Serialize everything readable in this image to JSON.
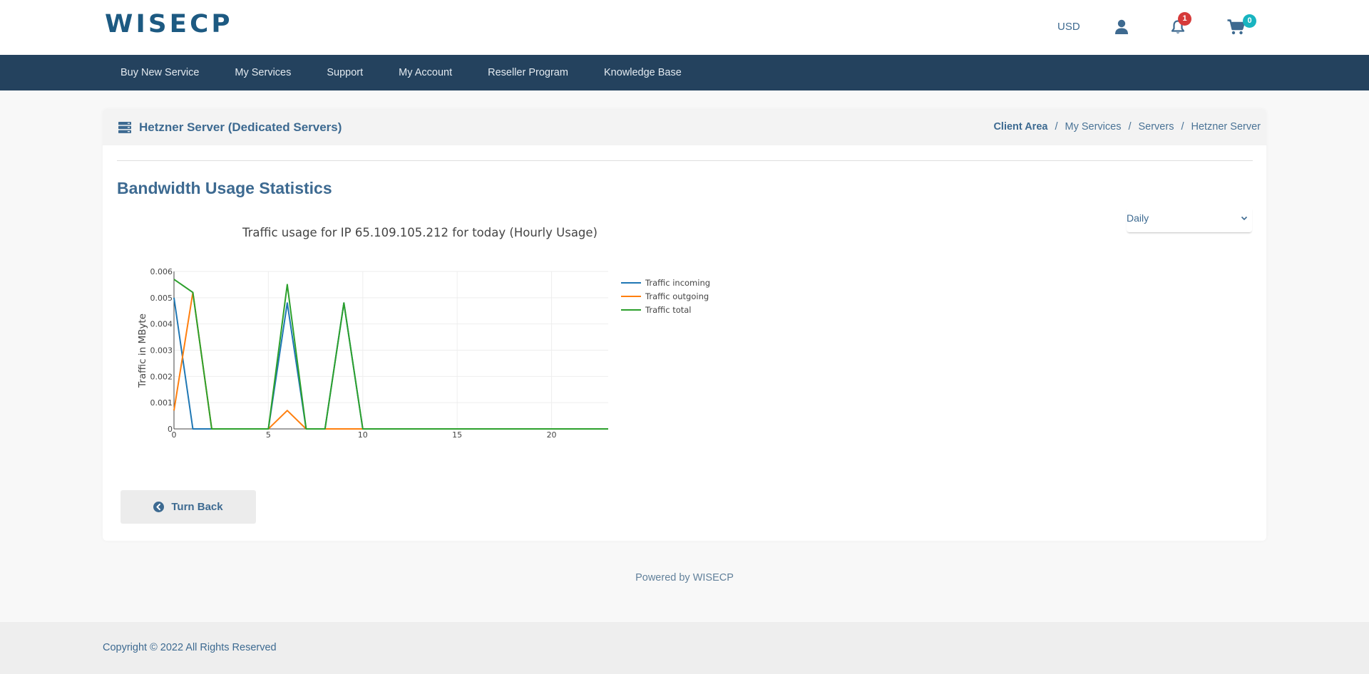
{
  "header": {
    "logo": "WISECP",
    "currency": "USD",
    "icons": [
      "user-icon",
      "bell-icon",
      "cart-icon"
    ],
    "notifications_count": "1",
    "cart_count": "0"
  },
  "nav": {
    "items": [
      {
        "label": "Buy New Service"
      },
      {
        "label": "My Services"
      },
      {
        "label": "Support"
      },
      {
        "label": "My Account"
      },
      {
        "label": "Reseller Program"
      },
      {
        "label": "Knowledge Base"
      }
    ]
  },
  "page": {
    "title_icon": "server-icon",
    "title": "Hetzner Server (Dedicated Servers)",
    "breadcrumb": [
      {
        "label": "Client Area"
      },
      {
        "label": "My Services"
      },
      {
        "label": "Servers"
      },
      {
        "label": "Hetzner Server"
      }
    ],
    "breadcrumb_separator": "/"
  },
  "section": {
    "heading": "Bandwidth Usage Statistics",
    "period_select": {
      "selected": "Daily"
    }
  },
  "chart_data": {
    "type": "line",
    "title": "Traffic usage for IP 65.109.105.212 for today (Hourly Usage)",
    "xlabel": "",
    "ylabel": "Traffic in MByte",
    "x": [
      0,
      1,
      2,
      3,
      4,
      5,
      6,
      7,
      8,
      9,
      10,
      11,
      12,
      13,
      14,
      15,
      16,
      17,
      18,
      19,
      20,
      21,
      22,
      23
    ],
    "xlim": [
      0,
      23
    ],
    "ylim": [
      0,
      0.006
    ],
    "xticks": [
      0,
      5,
      10,
      15,
      20
    ],
    "yticks": [
      0,
      0.001,
      0.002,
      0.003,
      0.004,
      0.005,
      0.006
    ],
    "grid": true,
    "legend_position": "right",
    "series": [
      {
        "name": "Traffic incoming",
        "color": "#1f77b4",
        "values": [
          0.005,
          0,
          0,
          0,
          0,
          0,
          0.0048,
          0,
          0,
          0.0048,
          0,
          0,
          0,
          0,
          0,
          0,
          0,
          0,
          0,
          0,
          0,
          0,
          0,
          0
        ]
      },
      {
        "name": "Traffic outgoing",
        "color": "#ff7f0e",
        "values": [
          0.0007,
          0.0052,
          0,
          0,
          0,
          0,
          0.0007,
          0,
          0,
          0,
          0,
          0,
          0,
          0,
          0,
          0,
          0,
          0,
          0,
          0,
          0,
          0,
          0,
          0
        ]
      },
      {
        "name": "Traffic total",
        "color": "#2ca02c",
        "values": [
          0.0057,
          0.0052,
          0,
          0,
          0,
          0,
          0.0055,
          0,
          0,
          0.0048,
          0,
          0,
          0,
          0,
          0,
          0,
          0,
          0,
          0,
          0,
          0,
          0,
          0,
          0
        ]
      }
    ]
  },
  "actions": {
    "back_label": "Turn Back",
    "back_icon": "chevron-left-circle-icon"
  },
  "footer": {
    "powered_by": "Powered by WISECP",
    "copyright": "Copyright © 2022 All Rights Reserved"
  },
  "colors": {
    "brand": "#1d5a82",
    "nav_bg": "#24425e",
    "accent_text": "#3d6a91",
    "notification_badge": "#d63a3a",
    "cart_badge": "#18b4c0"
  }
}
